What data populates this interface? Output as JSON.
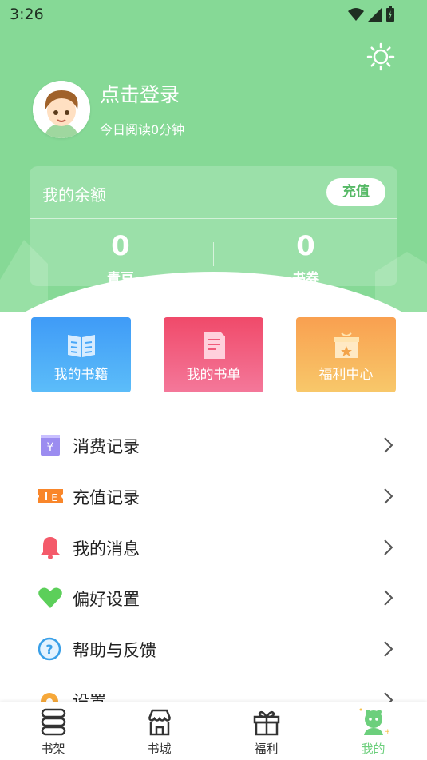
{
  "status": {
    "time": "3:26"
  },
  "user": {
    "login_label": "点击登录",
    "reading_today": "今日阅读0分钟"
  },
  "balance": {
    "title": "我的余额",
    "recharge_label": "充值",
    "stats": [
      {
        "value": "0",
        "label": "青豆"
      },
      {
        "value": "0",
        "label": "书券"
      }
    ]
  },
  "shortcuts": [
    {
      "label": "我的书籍",
      "icon": "book-icon",
      "color": "#4aa8f8"
    },
    {
      "label": "我的书单",
      "icon": "booklist-icon",
      "color": "#f05a7a"
    },
    {
      "label": "福利中心",
      "icon": "gift-box-icon",
      "color": "#f8b85a"
    }
  ],
  "menu": [
    {
      "label": "消费记录",
      "icon": "wallet-icon"
    },
    {
      "label": "充值记录",
      "icon": "ticket-icon"
    },
    {
      "label": "我的消息",
      "icon": "bell-icon"
    },
    {
      "label": "偏好设置",
      "icon": "heart-icon"
    },
    {
      "label": "帮助与反馈",
      "icon": "help-icon"
    },
    {
      "label": "设置",
      "icon": "settings-icon"
    }
  ],
  "bottom_nav": [
    {
      "label": "书架",
      "icon": "bookshelf-icon"
    },
    {
      "label": "书城",
      "icon": "bookstore-icon"
    },
    {
      "label": "福利",
      "icon": "gift-icon"
    },
    {
      "label": "我的",
      "icon": "profile-icon",
      "active": true
    }
  ],
  "colors": {
    "header_green": "#86d996",
    "active_green": "#6ccf7c",
    "text_dark": "#222222"
  }
}
